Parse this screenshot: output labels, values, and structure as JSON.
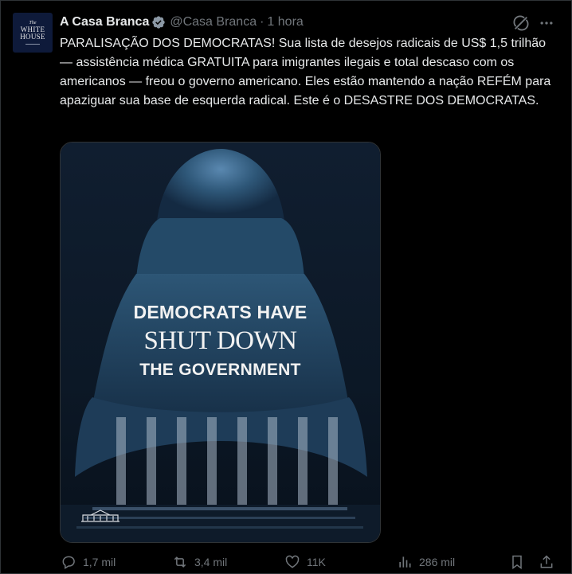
{
  "account": {
    "avatar_text": {
      "line0": "The",
      "line1": "WHITE",
      "line2": "HOUSE"
    },
    "name": "A Casa Branca",
    "handle": "@Casa Branca",
    "separator": "·",
    "time": "1 hora",
    "verified_color": "#8b98a5"
  },
  "tweet": {
    "text": "PARALISAÇÃO DOS DEMOCRATAS! Sua lista de desejos radicais de US$ 1,5 trilhão — assistência médica GRATUITA para imigrantes ilegais e total descaso com os americanos — freou o governo americano. Eles estão mantendo a nação REFÉM para apaziguar sua base de esquerda radical. Este é o DESASTRE DOS DEMOCRATAS."
  },
  "media": {
    "line1": "DEMOCRATS HAVE",
    "line2": "SHUT DOWN",
    "line3": "THE GOVERNMENT"
  },
  "actions": {
    "replies": "1,7 mil",
    "reposts": "3,4 mil",
    "likes": "11K",
    "views": "286 mil"
  },
  "icons": [
    "grok-icon",
    "more-icon",
    "verified-icon",
    "reply-icon",
    "repost-icon",
    "like-icon",
    "views-icon",
    "bookmark-icon",
    "share-icon",
    "white-house-logo-icon"
  ],
  "colors": {
    "background": "#000000",
    "text": "#e7e9ea",
    "muted": "#71767b",
    "border": "#2f3336"
  }
}
